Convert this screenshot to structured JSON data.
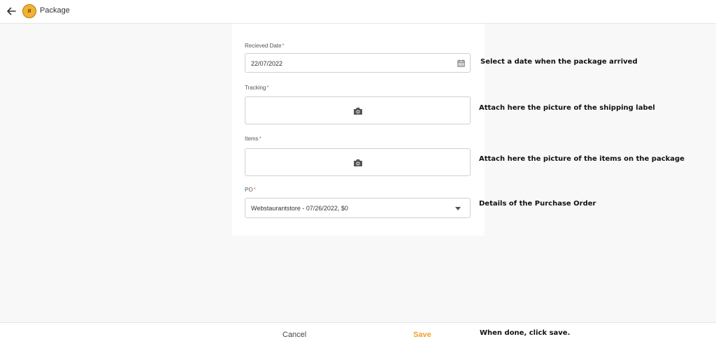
{
  "header": {
    "title": "Package"
  },
  "form": {
    "received_date": {
      "label": "Recieved Date",
      "required_mark": "*",
      "value": "22/07/2022"
    },
    "tracking": {
      "label": "Tracking",
      "required_mark": "*"
    },
    "items": {
      "label": "Items",
      "required_mark": "*"
    },
    "po": {
      "label": "PO",
      "required_mark": "*",
      "selected": "Webstaurantstore - 07/26/2022, $0"
    }
  },
  "notes": {
    "date": "Select a date when the package arrived",
    "tracking": "Attach here the picture of the shipping label",
    "items": "Attach here the picture of the items on the package",
    "po": "Details of the Purchase Order",
    "save": "When done, click save."
  },
  "footer": {
    "cancel_label": "Cancel",
    "save_label": "Save"
  },
  "colors": {
    "accent": "#f0a030",
    "required": "#e8742a"
  },
  "icons": [
    "arrow-left-icon",
    "app-logo",
    "calendar-icon",
    "camera-icon",
    "dropdown-arrow-icon"
  ]
}
